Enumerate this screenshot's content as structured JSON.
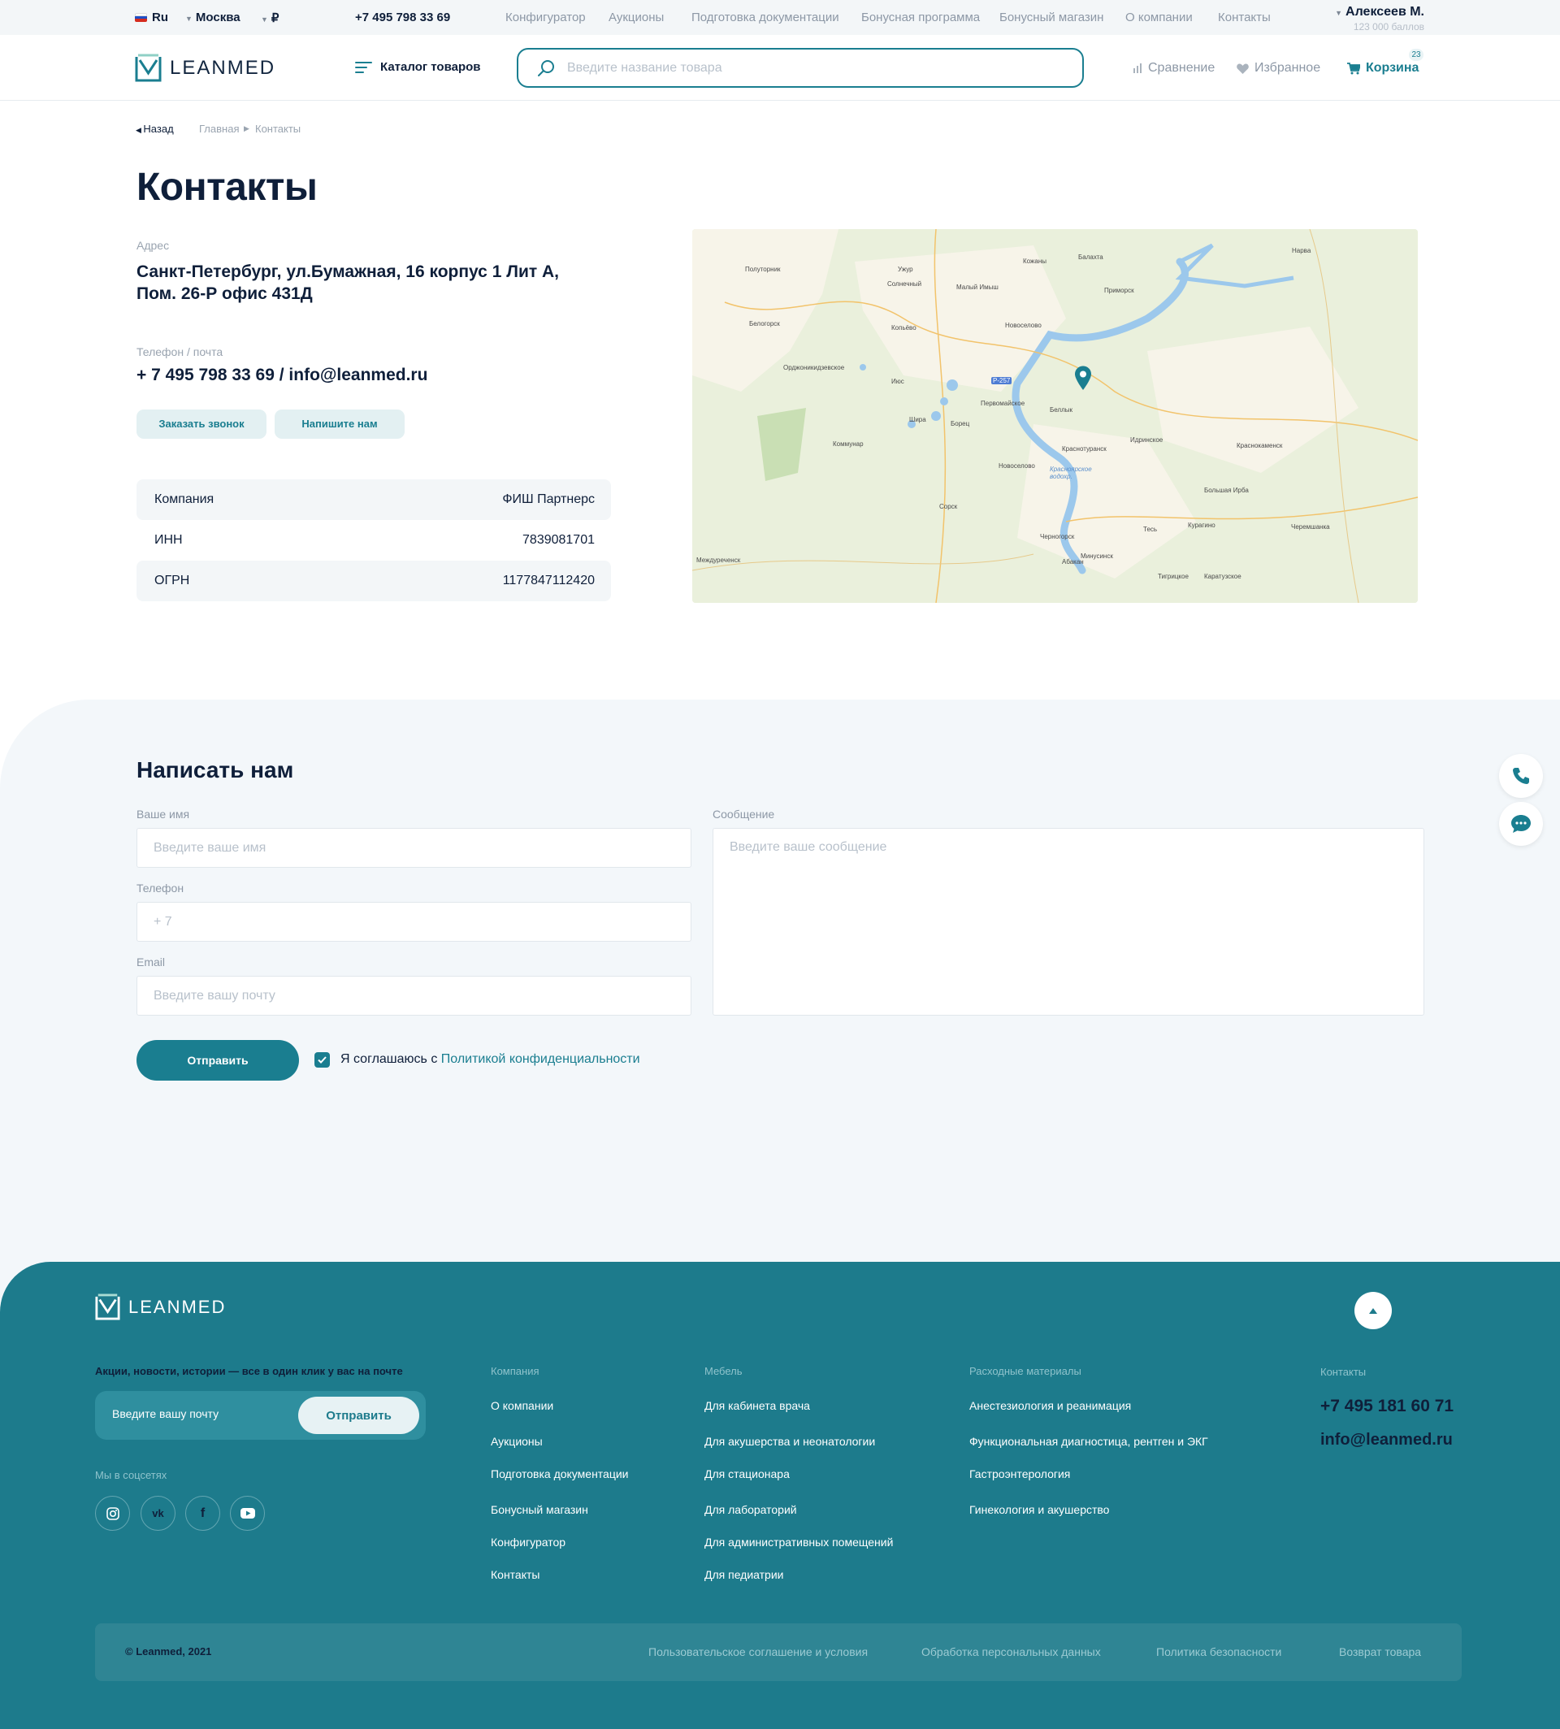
{
  "topbar": {
    "lang": "Ru",
    "city": "Москва",
    "currency": "₽",
    "phone": "+7 495 798 33 69",
    "nav": [
      "Конфигуратор",
      "Аукционы",
      "Подготовка документации",
      "Бонусная программа",
      "Бонусный магазин",
      "О компании",
      "Контакты"
    ],
    "user_name": "Алексеев М.",
    "user_points": "123 000 баллов"
  },
  "header": {
    "logo": "LEANMED",
    "catalog": "Каталог товаров",
    "search_placeholder": "Введите название товара",
    "compare": "Сравнение",
    "favorites": "Избранное",
    "cart": "Корзина",
    "cart_count": "23"
  },
  "breadcrumb": {
    "back": "Назад",
    "home": "Главная",
    "current": "Контакты"
  },
  "contacts": {
    "title": "Контакты",
    "address_label": "Адрес",
    "address_line1": "Санкт-Петербург, ул.Бумажная, 16 корпус 1 Лит А,",
    "address_line2": "Пом. 26-Р офис 431Д",
    "phone_label": "Телефон / почта",
    "phone_mail": "+ 7 495 798 33 69 / info@leanmed.ru",
    "call_button": "Заказать звонок",
    "write_button": "Напишите нам",
    "requisites": [
      {
        "key": "Компания",
        "value": "ФИШ Партнерс"
      },
      {
        "key": "ИНН",
        "value": "7839081701"
      },
      {
        "key": "ОГРН",
        "value": "1177847112420"
      }
    ]
  },
  "map": {
    "towns": [
      "Полуторник",
      "Ужур",
      "Кожаны",
      "Балахта",
      "Нарва",
      "Солнечный",
      "Малый Имыш",
      "Приморск",
      "Белогорск",
      "Копьёво",
      "Новоселово",
      "Орджоникидзевское",
      "Июс",
      "Первомайское",
      "Беллык",
      "Шира",
      "Борец",
      "Коммунар",
      "Краснотуранск",
      "Идринское",
      "Краснокаменск",
      "Сорск",
      "Новоселово",
      "Большая Ирба",
      "Черногорск",
      "Тесь",
      "Курагино",
      "Черемшанка",
      "Междуреченск",
      "Абакан",
      "Минусинск",
      "Тигрицкое",
      "Каратузское"
    ],
    "road_label": "Р-257",
    "reservoir_label": "Красноярское водохр.",
    "pin_color": "#1a7e90"
  },
  "form": {
    "title": "Написать нам",
    "name_label": "Ваше имя",
    "name_placeholder": "Введите ваше имя",
    "phone_label": "Телефон",
    "phone_placeholder": "+ 7",
    "email_label": "Email",
    "email_placeholder": "Введите вашу почту",
    "message_label": "Сообщение",
    "message_placeholder": "Введите ваше сообщение",
    "submit": "Отправить",
    "agree_text": "Я соглашаюсь с ",
    "agree_link": "Политикой конфиденциальности"
  },
  "footer": {
    "logo": "LEANMED",
    "tagline": "Акции, новости, истории — все в один клик у вас на почте",
    "subscribe_placeholder": "Введите вашу почту",
    "subscribe_button": "Отправить",
    "social_label": "Мы в соцсетях",
    "social": [
      "instagram-icon",
      "vk-icon",
      "facebook-icon",
      "youtube-icon"
    ],
    "col_company": {
      "title": "Компания",
      "items": [
        "О компании",
        "Аукционы",
        "Подготовка документации",
        "Бонусный магазин",
        "Конфигуратор",
        "Контакты"
      ]
    },
    "col_furniture": {
      "title": "Мебель",
      "items": [
        "Для кабинета врача",
        "Для акушерства и неонатологии",
        "Для стационара",
        "Для лабораторий",
        "Для административных помещений",
        "Для педиатрии"
      ]
    },
    "col_consumables": {
      "title": "Расходные материалы",
      "items": [
        "Анестезиология и реанимация",
        "Функциональная диагностица, рентген и ЭКГ",
        "Гастроэнтерология",
        "Гинекология и акушерство"
      ]
    },
    "contacts_title": "Контакты",
    "phone": "+7 495 181 60 71",
    "email": "info@leanmed.ru",
    "copyright": "© Leanmed, 2021",
    "bottom_links": [
      "Пользовательское соглашение и условия",
      "Обработка персональных данных",
      "Политика безопасности",
      "Возврат товара"
    ]
  },
  "colors": {
    "accent": "#1a7e90",
    "footer_bg": "#1d7b8c",
    "dark_text": "#0f1f3a",
    "muted": "#8d98a6"
  }
}
